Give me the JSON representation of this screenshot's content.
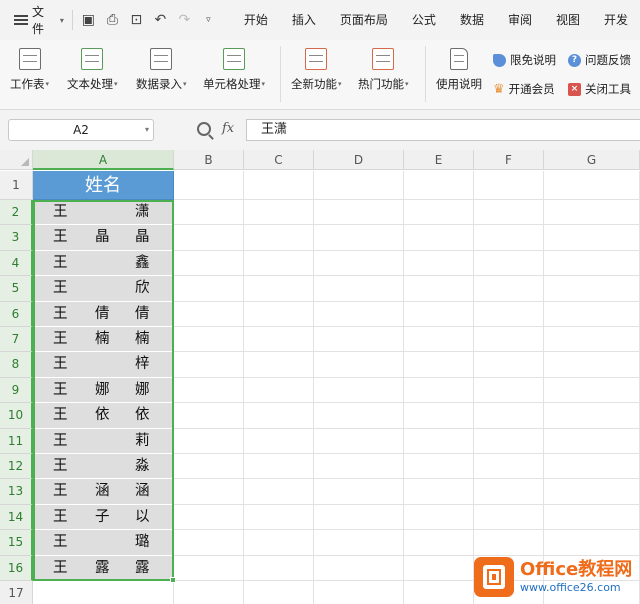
{
  "menubar": {
    "file_label": "文件",
    "tabs": [
      "开始",
      "插入",
      "页面布局",
      "公式",
      "数据",
      "审阅",
      "视图",
      "开发"
    ]
  },
  "ribbon": {
    "buttons": [
      {
        "label": "工作表",
        "arrow": true,
        "icon": "worksheet-icon"
      },
      {
        "label": "文本处理",
        "arrow": true,
        "icon": "text-process-icon"
      },
      {
        "label": "数据录入",
        "arrow": true,
        "icon": "data-entry-icon"
      },
      {
        "label": "单元格处理",
        "arrow": true,
        "icon": "cell-process-icon"
      },
      {
        "label": "全新功能",
        "arrow": true,
        "icon": "new-feature-icon"
      },
      {
        "label": "热门功能",
        "arrow": true,
        "icon": "hot-feature-icon"
      },
      {
        "label": "使用说明",
        "arrow": false,
        "icon": "usage-guide-icon"
      }
    ],
    "small": {
      "limited_free": "限免说明",
      "feedback": "问题反馈",
      "open_member": "开通会员",
      "close_tool": "关闭工具"
    }
  },
  "formula_bar": {
    "name_box": "A2",
    "fx_label": "fx",
    "value": "王潇"
  },
  "sheet": {
    "columns": [
      "A",
      "B",
      "C",
      "D",
      "E",
      "F",
      "G"
    ],
    "header_cell": "姓名",
    "rows": [
      {
        "n": "1"
      },
      {
        "n": "2",
        "c": [
          "王",
          "",
          "潇"
        ]
      },
      {
        "n": "3",
        "c": [
          "王",
          "晶",
          "晶"
        ]
      },
      {
        "n": "4",
        "c": [
          "王",
          "",
          "鑫"
        ]
      },
      {
        "n": "5",
        "c": [
          "王",
          "",
          "欣"
        ]
      },
      {
        "n": "6",
        "c": [
          "王",
          "倩",
          "倩"
        ]
      },
      {
        "n": "7",
        "c": [
          "王",
          "楠",
          "楠"
        ]
      },
      {
        "n": "8",
        "c": [
          "王",
          "",
          "梓"
        ]
      },
      {
        "n": "9",
        "c": [
          "王",
          "娜",
          "娜"
        ]
      },
      {
        "n": "10",
        "c": [
          "王",
          "依",
          "依"
        ]
      },
      {
        "n": "11",
        "c": [
          "王",
          "",
          "莉"
        ]
      },
      {
        "n": "12",
        "c": [
          "王",
          "",
          "淼"
        ]
      },
      {
        "n": "13",
        "c": [
          "王",
          "涵",
          "涵"
        ]
      },
      {
        "n": "14",
        "c": [
          "王",
          "子",
          "以"
        ]
      },
      {
        "n": "15",
        "c": [
          "王",
          "",
          "璐"
        ]
      },
      {
        "n": "16",
        "c": [
          "王",
          "露",
          "露"
        ]
      },
      {
        "n": "17"
      }
    ]
  },
  "watermark": {
    "title": "Office教程网",
    "url": "www.office26.com"
  },
  "colors": {
    "header_fill": "#5b9bd5",
    "data_fill": "#dedede",
    "selection": "#4caf50",
    "brand": "#ef6c1b"
  }
}
